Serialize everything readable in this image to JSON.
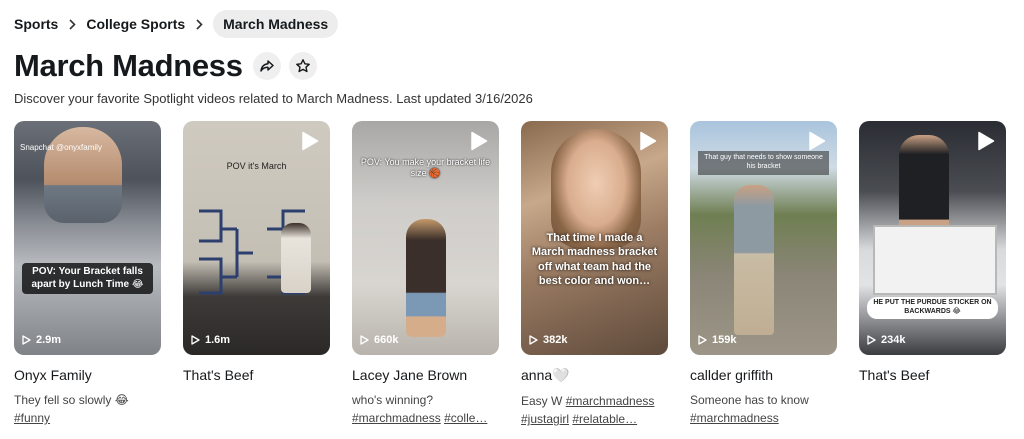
{
  "breadcrumb": {
    "items": [
      "Sports",
      "College Sports"
    ],
    "current": "March Madness"
  },
  "header": {
    "title": "March Madness",
    "subtitle": "Discover your favorite Spotlight videos related to March Madness. Last updated 3/16/2026"
  },
  "cards": [
    {
      "name": "Onyx Family",
      "views": "2.9m",
      "overlay_text": "POV: Your Bracket falls apart by Lunch Time 😂",
      "watermark": "Snapchat @onyxfamily",
      "desc_text": "They fell so slowly 😂",
      "tags": [
        "#funny"
      ]
    },
    {
      "name": "That's Beef",
      "views": "1.6m",
      "overlay_text": "POV it's March",
      "desc_text": "",
      "tags": []
    },
    {
      "name": "Lacey Jane Brown",
      "views": "660k",
      "overlay_text": "POV: You make your bracket life size 🏀",
      "desc_text": "who's winning?",
      "tags": [
        "#marchmadness",
        "#colle…"
      ]
    },
    {
      "name": "anna🤍",
      "views": "382k",
      "overlay_text": "That time I made a March madness bracket off what team had the best color and won…",
      "desc_text": "Easy W",
      "tags": [
        "#marchmadness",
        "#justagirl",
        "#relatable…"
      ]
    },
    {
      "name": "callder griffith",
      "views": "159k",
      "overlay_text": "That guy that needs to show someone his bracket",
      "desc_text": "Someone has to know",
      "tags": [
        "#marchmadness"
      ]
    },
    {
      "name": "That's Beef",
      "views": "234k",
      "overlay_text": "HE PUT THE PURDUE STICKER ON BACKWARDS 😂",
      "desc_text": "",
      "tags": []
    }
  ]
}
